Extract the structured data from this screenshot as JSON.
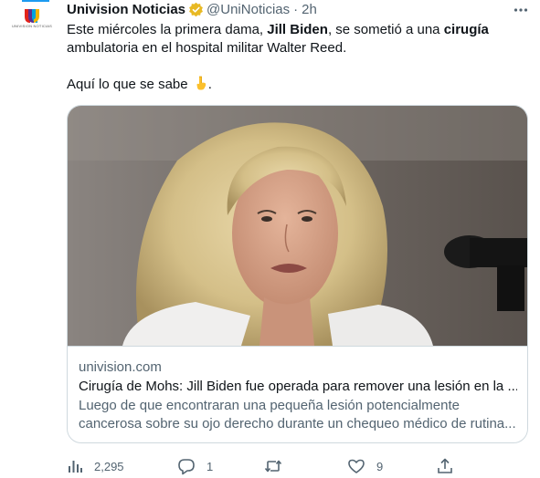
{
  "author": {
    "display_name": "Univision Noticias",
    "handle": "@UniNoticias",
    "separator": "·",
    "time": "2h",
    "avatar_caption": "UNIVISION NOTICIAS"
  },
  "tweet": {
    "line1_a": "Este miércoles la primera dama, ",
    "line1_b": "Jill Biden",
    "line1_c": ", se sometió a una ",
    "line1_d": "cirugía",
    "line2": "ambulatoria en el hospital militar Walter Reed.",
    "line3": "Aquí lo que se sabe",
    "line3_end": "."
  },
  "card": {
    "domain": "univision.com",
    "title": "Cirugía de Mohs: Jill Biden fue operada para remover una lesión en la ...",
    "description": "Luego de que encontraran una pequeña lesión potencialmente cancerosa sobre su ojo derecho durante un chequeo médico de rutina..."
  },
  "actions": {
    "views": "2,295",
    "replies": "1",
    "retweets": "",
    "likes": "9"
  },
  "colors": {
    "accent": "#1d9bf0",
    "secondary_text": "#536471",
    "border": "#cfd9de"
  },
  "icons": [
    "univision-logo-icon",
    "verified-badge-icon",
    "more-icon",
    "pointing-down-emoji-icon",
    "views-icon",
    "reply-icon",
    "retweet-icon",
    "like-icon",
    "share-icon"
  ]
}
